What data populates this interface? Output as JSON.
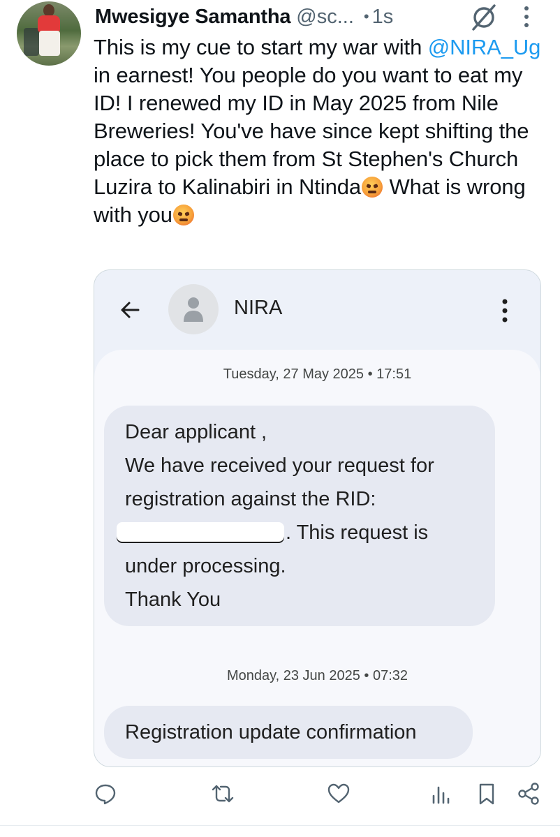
{
  "tweet": {
    "author": {
      "display_name": "Mwesigye Samantha",
      "handle": "@sc...",
      "time": "1s",
      "avatar_icon": "profile-photo"
    },
    "text_parts": {
      "p1": "This is my cue to start my war with ",
      "mention": "@NIRA_Ug",
      "p2": " in earnest! You people do you want to eat my ID! I renewed my ID in May 2025 from Nile Breweries! You've have since kept shifting the place to pick them from St Stephen's Church Luzira to Kalinabiri in Ntinda",
      "p3": " What is wrong with you"
    },
    "emoji_icon": "angry-face-emoji",
    "colors": {
      "mention": "#1d9bf0",
      "secondary_text": "#536471"
    }
  },
  "sms_screenshot": {
    "contact_name": "NIRA",
    "messages": [
      {
        "date": "Tuesday, 27 May 2025 • 17:51",
        "lines": [
          "Dear applicant ,",
          "We have received your request for",
          "registration against the RID:",
          ". This request is",
          "under processing.",
          "Thank You"
        ]
      },
      {
        "date": "Monday, 23 Jun 2025 • 07:32",
        "lines": [
          "Registration update confirmation"
        ]
      }
    ]
  },
  "actions": [
    "reply-icon",
    "retweet-icon",
    "like-icon",
    "views-icon",
    "bookmark-icon",
    "share-icon"
  ]
}
